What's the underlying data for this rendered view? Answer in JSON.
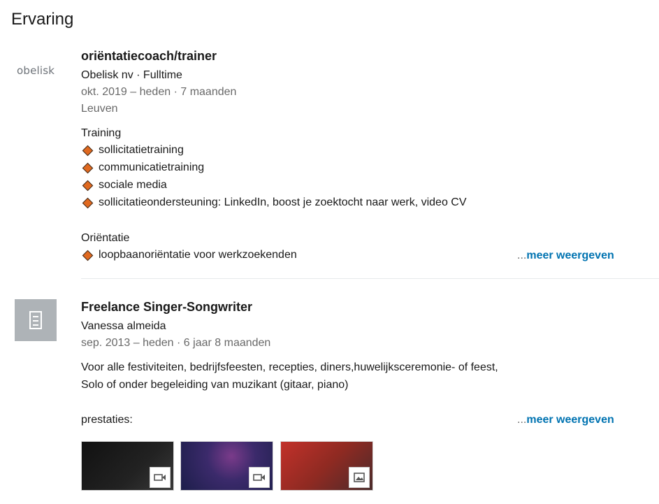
{
  "section": {
    "title": "Ervaring"
  },
  "entries": [
    {
      "logo_text": "obelisk",
      "title": "oriëntatiecoach/trainer",
      "company": "Obelisk nv · Fulltime",
      "dates": "okt. 2019 – heden",
      "duration": "7 maanden",
      "location": "Leuven",
      "group1_heading": "Training",
      "group1_items": [
        "sollicitatietraining",
        "communicatietraining",
        "sociale media",
        "sollicitatieondersteuning: LinkedIn, boost je zoektocht naar werk, video CV"
      ],
      "group2_heading": "Oriëntatie",
      "group2_items": [
        "loopbaanoriëntatie voor werkzoekenden"
      ],
      "see_more_prefix": "...",
      "see_more": "meer weergeven"
    },
    {
      "title": "Freelance Singer-Songwriter",
      "company": "Vanessa almeida",
      "dates": "sep. 2013 – heden",
      "duration": "6 jaar 8 maanden",
      "desc_line1": "Voor alle festiviteiten, bedrijfsfeesten, recepties, diners,huwelijksceremonie- of feest,",
      "desc_line2": "Solo of onder begeleiding van muzikant (gitaar, piano)",
      "desc_line3": "prestaties:",
      "see_more_prefix": "...",
      "see_more": "meer weergeven",
      "media": [
        {
          "type": "video-icon"
        },
        {
          "type": "video-icon"
        },
        {
          "type": "image-icon"
        }
      ]
    }
  ],
  "colors": {
    "link": "#0073b1",
    "diamond": "#e0691f",
    "logo_bg": "#aeb3b7"
  }
}
